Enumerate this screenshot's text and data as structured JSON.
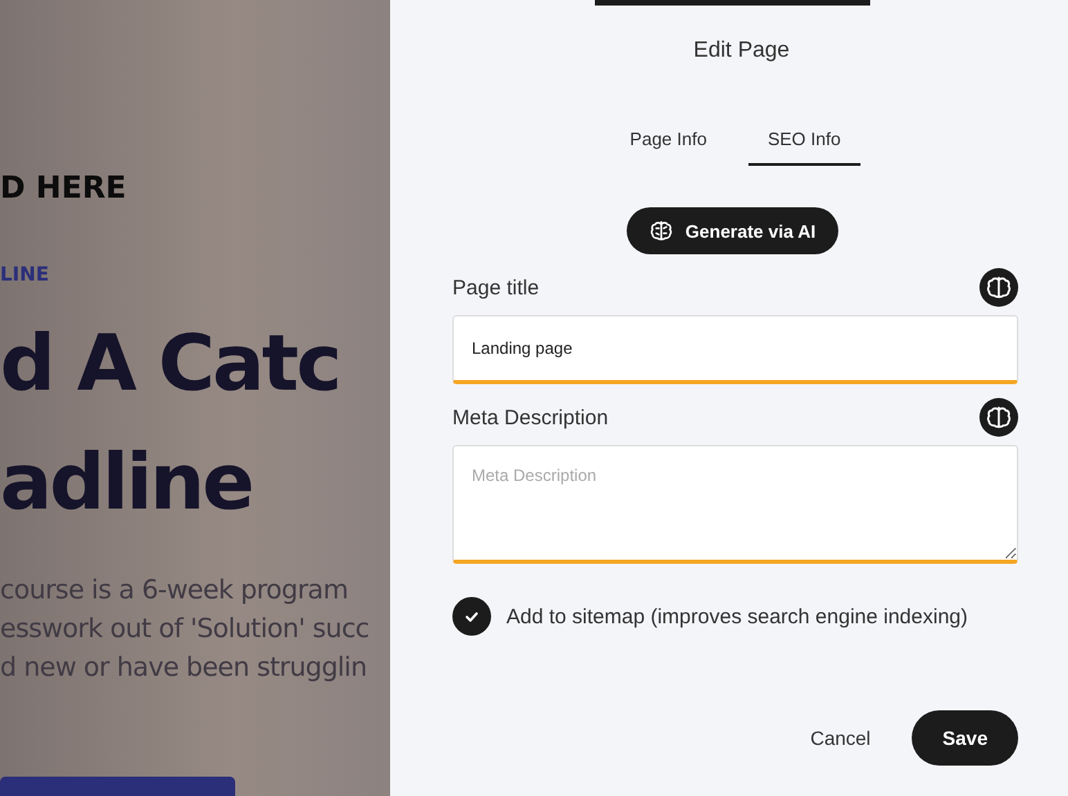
{
  "background_page": {
    "logo_text": "D HERE",
    "eyebrow": "LINE",
    "headline_lines": [
      "d A Catc",
      "adline"
    ],
    "paragraph_lines": [
      "course is a 6-week program",
      "esswork out of 'Solution' succ",
      "d new or have been strugglin"
    ]
  },
  "panel": {
    "title": "Edit Page",
    "tabs": [
      {
        "label": "Page Info",
        "selected": false
      },
      {
        "label": "SEO Info",
        "selected": true
      }
    ],
    "generate_button": "Generate via AI",
    "fields": [
      {
        "kind": "input",
        "label": "Page title",
        "value": "Landing page"
      },
      {
        "kind": "textarea",
        "label": "Meta Description",
        "placeholder": "Meta Description"
      }
    ],
    "sitemap": {
      "label": "Add to sitemap (improves search engine indexing)",
      "checked": true
    },
    "buttons": {
      "cancel": "Cancel",
      "save": "Save"
    }
  }
}
